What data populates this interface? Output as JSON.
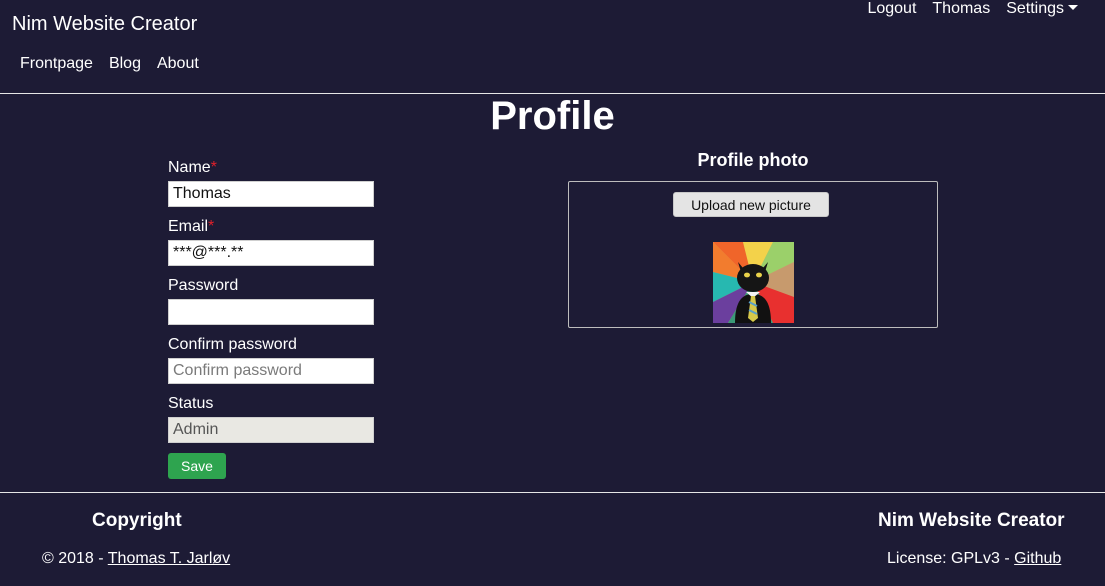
{
  "header": {
    "brand": "Nim Website Creator",
    "user_menu": {
      "logout": "Logout",
      "username": "Thomas",
      "settings": "Settings"
    },
    "nav": [
      "Frontpage",
      "Blog",
      "About"
    ]
  },
  "page": {
    "title": "Profile"
  },
  "form": {
    "name_label": "Name",
    "name_value": "Thomas",
    "email_label": "Email",
    "email_value": "***@***.**",
    "required_mark": "*",
    "password_label": "Password",
    "password_value": "",
    "confirm_label": "Confirm password",
    "confirm_placeholder": "Confirm password",
    "status_label": "Status",
    "status_value": "Admin",
    "save_label": "Save"
  },
  "photo": {
    "title": "Profile photo",
    "upload_label": "Upload new picture",
    "avatar_icon": "cat-in-tie-avatar"
  },
  "footer": {
    "left_title": "Copyright",
    "copyright_prefix": "© 2018 - ",
    "author": "Thomas T. Jarløv",
    "right_title": "Nim Website Creator",
    "license_prefix": "License: GPLv3 - ",
    "github": "Github"
  },
  "colors": {
    "background": "#1d1b35",
    "save_button": "#2ea44f",
    "required": "#e0202a"
  }
}
